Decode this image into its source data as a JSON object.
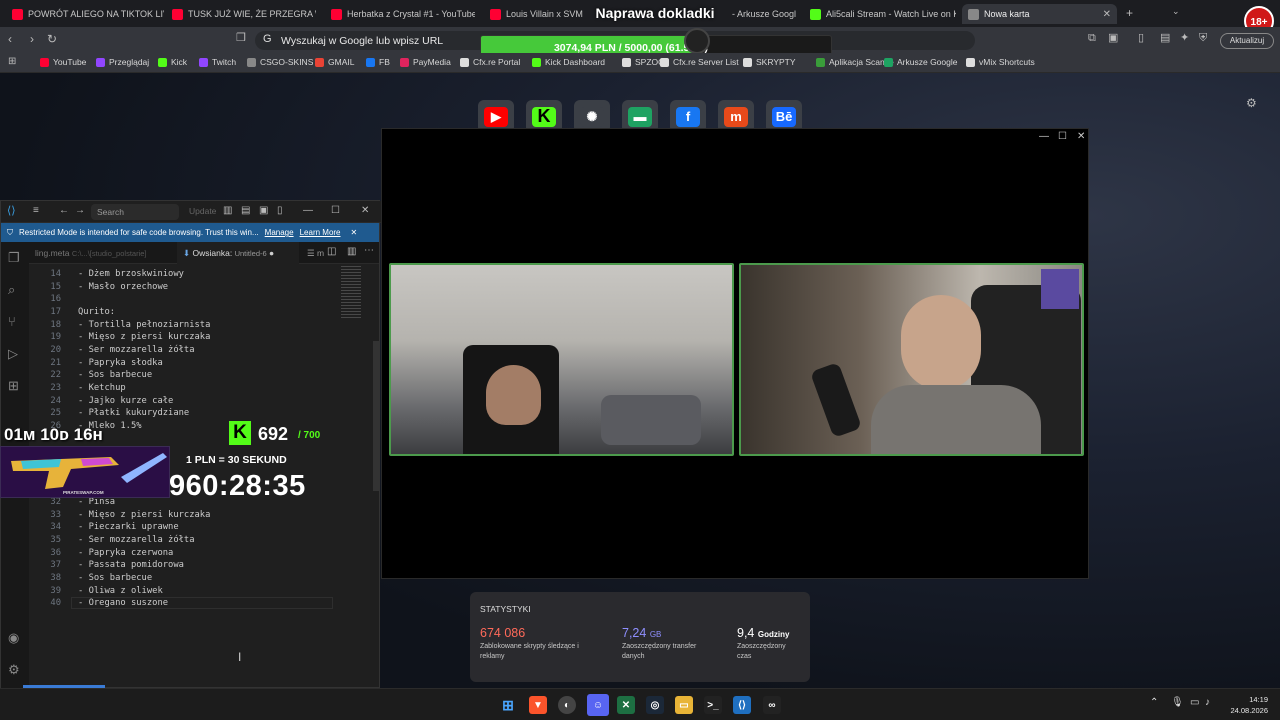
{
  "browser": {
    "tabs": [
      {
        "title": "POWRÓT ALIEGO NA TIKTOK LIVE",
        "color": "#ff0033"
      },
      {
        "title": "TUSK JUŻ WIE, ŻE PRZEGRA W 2027",
        "color": "#ff0033"
      },
      {
        "title": "Herbatka z Crystal #1 - YouTube",
        "color": "#ff0033"
      },
      {
        "title": "Louis Villain x SVM",
        "color": "#ff0033"
      },
      {
        "title": "- Arkusze Googl",
        "color": "#1ea362"
      },
      {
        "title": "Ali5cali Stream - Watch Live on Kick",
        "color": "#53fc18"
      },
      {
        "title": "Nowa karta",
        "color": "#888888"
      }
    ],
    "close_tab": "✕",
    "new_tab": "+",
    "address_placeholder": "Wyszukaj w Google lub wpisz URL",
    "update_label": "Aktualizuj",
    "bookmarks": [
      {
        "label": "YouTube",
        "color": "#ff0033"
      },
      {
        "label": "Przeglądaj",
        "color": "#9146ff"
      },
      {
        "label": "Kick",
        "color": "#53fc18"
      },
      {
        "label": "Twitch",
        "color": "#9146ff"
      },
      {
        "label": "CSGO-SKINS",
        "color": "#888888"
      },
      {
        "label": "GMAIL",
        "color": "#ea4335"
      },
      {
        "label": "FB",
        "color": "#1877f2"
      },
      {
        "label": "PayMedia",
        "color": "#e0245e"
      },
      {
        "label": "Cfx.re Portal",
        "color": "#dddddd"
      },
      {
        "label": "Kick Dashboard",
        "color": "#53fc18"
      },
      {
        "label": "SPZOO",
        "color": "#dddddd"
      },
      {
        "label": "Cfx.re Server List",
        "color": "#dddddd"
      },
      {
        "label": "SKRYPTY",
        "color": "#dddddd"
      },
      {
        "label": "Aplikacja Scanye",
        "color": "#3a9d3a"
      },
      {
        "label": "Arkusze Google",
        "color": "#1ea362"
      },
      {
        "label": "vMix Shortcuts",
        "color": "#dddddd"
      }
    ]
  },
  "overlay": {
    "title": "Naprawa dokladki",
    "progress_text": "3074,94 PLN / 5000,00 (61.50%)",
    "progress_fraction": 0.615,
    "age_badge": "18+"
  },
  "shortcuts": [
    {
      "name": "youtube",
      "color": "#ff0000",
      "glyph": "▶"
    },
    {
      "name": "kick",
      "color": "#53fc18",
      "glyph": "K"
    },
    {
      "name": "chatgpt",
      "color": "#3b3f46",
      "glyph": "✺"
    },
    {
      "name": "twitch-green",
      "color": "#1ea362",
      "glyph": "▬"
    },
    {
      "name": "facebook",
      "color": "#1877f2",
      "glyph": "f"
    },
    {
      "name": "m-app",
      "color": "#e84a1a",
      "glyph": "m"
    },
    {
      "name": "behance",
      "color": "#1769ff",
      "glyph": "Bē"
    }
  ],
  "stats": {
    "title": "STATYSTYKI",
    "items": [
      {
        "value": "674 086",
        "unit": "",
        "desc": "Zablokowane skrypty śledzące i reklamy",
        "color": "#ff6a5a"
      },
      {
        "value": "7,24",
        "unit": "GB",
        "desc": "Zaoszczędzony transfer danych",
        "color": "#8f8fff"
      },
      {
        "value": "9,4",
        "unit": "Godziny",
        "desc": "Zaoszczędzony czas",
        "color": "#ffffff"
      }
    ]
  },
  "vscode": {
    "search": "Search",
    "update": "Update",
    "restricted_text": "Restricted Mode is intended for safe code browsing. Trust this win...",
    "manage": "Manage",
    "learn_more": "Learn More",
    "tab1": "ling.meta",
    "tab1_path": "C:\\...\\[studio_polstarie]",
    "tab2": "Owsianka",
    "tab2_file": "Untitled-6",
    "tab3": "m",
    "lines": [
      {
        "n": "14",
        "t": "- Dżem brzoskwiniowy"
      },
      {
        "n": "15",
        "t": "- Masło orzechowe"
      },
      {
        "n": "16",
        "t": ""
      },
      {
        "n": "17",
        "t": "Qurito:"
      },
      {
        "n": "18",
        "t": "- Tortilla pełnoziarnista"
      },
      {
        "n": "19",
        "t": "- Mięso z piersi kurczaka"
      },
      {
        "n": "20",
        "t": "- Ser mozzarella żółta"
      },
      {
        "n": "21",
        "t": "- Papryka słodka"
      },
      {
        "n": "22",
        "t": "- Sos barbecue"
      },
      {
        "n": "23",
        "t": "- Ketchup"
      },
      {
        "n": "24",
        "t": "- Jajko kurze całe"
      },
      {
        "n": "25",
        "t": "- Płatki kukurydziane"
      },
      {
        "n": "26",
        "t": "- Mleko 1.5%"
      },
      {
        "n": "32",
        "t": "- Pinsa"
      },
      {
        "n": "33",
        "t": "- Mięso z piersi kurczaka"
      },
      {
        "n": "34",
        "t": "- Pieczarki uprawne"
      },
      {
        "n": "35",
        "t": "- Ser mozzarella żółta"
      },
      {
        "n": "36",
        "t": "- Papryka czerwona"
      },
      {
        "n": "37",
        "t": "- Passata pomidorowa"
      },
      {
        "n": "38",
        "t": "- Sos barbecue"
      },
      {
        "n": "39",
        "t": "- Oliwa z oliwek"
      },
      {
        "n": "40",
        "t": "- Oregano suszone"
      }
    ]
  },
  "stream": {
    "countdown": "01м 10ᴅ 16н",
    "kick_count": "692",
    "kick_max": "/ 700",
    "rate": "1 PLN = 30 SEKUND",
    "timer": "960:28:35",
    "sponsor": "PIRATESWAP.COM"
  },
  "taskbar": {
    "time": "14:19",
    "date": "24.08.2026"
  }
}
